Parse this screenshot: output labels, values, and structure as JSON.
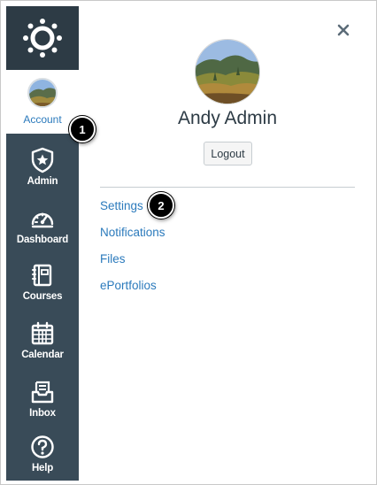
{
  "nav": {
    "account_label": "Account",
    "items": [
      {
        "label": "Admin",
        "icon": "shield-star-icon"
      },
      {
        "label": "Dashboard",
        "icon": "speedometer-icon"
      },
      {
        "label": "Courses",
        "icon": "book-icon"
      },
      {
        "label": "Calendar",
        "icon": "calendar-icon"
      },
      {
        "label": "Inbox",
        "icon": "inbox-icon"
      },
      {
        "label": "Help",
        "icon": "help-icon"
      }
    ]
  },
  "tray": {
    "user_name": "Andy Admin",
    "logout_label": "Logout",
    "links": [
      "Settings",
      "Notifications",
      "Files",
      "ePortfolios"
    ]
  },
  "callouts": [
    "1",
    "2"
  ],
  "colors": {
    "nav_bg": "#394b58",
    "logo_bg": "#2d3b45",
    "link": "#2b7abc",
    "text": "#2d3b45"
  }
}
